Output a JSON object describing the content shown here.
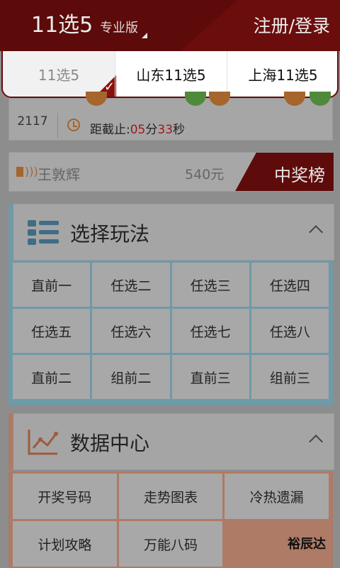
{
  "header": {
    "title": "11选5",
    "edition": "专业版",
    "login": "注册/登录"
  },
  "tabs": [
    {
      "label": "11选5",
      "selected": true
    },
    {
      "label": "山东11选5",
      "selected": false
    },
    {
      "label": "上海11选5",
      "selected": false
    }
  ],
  "issue": {
    "number": "2117",
    "countdown_prefix": "距截止:",
    "minutes": "05",
    "minutes_unit": "分",
    "seconds": "33",
    "seconds_unit": "秒"
  },
  "winner": {
    "name": "王敦辉",
    "amount": "540元",
    "rank_label": "中奖榜"
  },
  "play_section": {
    "title": "选择玩法",
    "items": [
      "直前一",
      "任选二",
      "任选三",
      "任选四",
      "任选五",
      "任选六",
      "任选七",
      "任选八",
      "直前二",
      "组前二",
      "直前三",
      "组前三"
    ]
  },
  "data_section": {
    "title": "数据中心",
    "items": [
      "开奖号码",
      "走势图表",
      "冷热遗漏",
      "计划攻略",
      "万能八码"
    ]
  },
  "watermark": "裕辰达",
  "colors": {
    "header": "#5c0a0a",
    "accent_blue": "#6f9aa8",
    "accent_orange": "#ad7b66"
  }
}
